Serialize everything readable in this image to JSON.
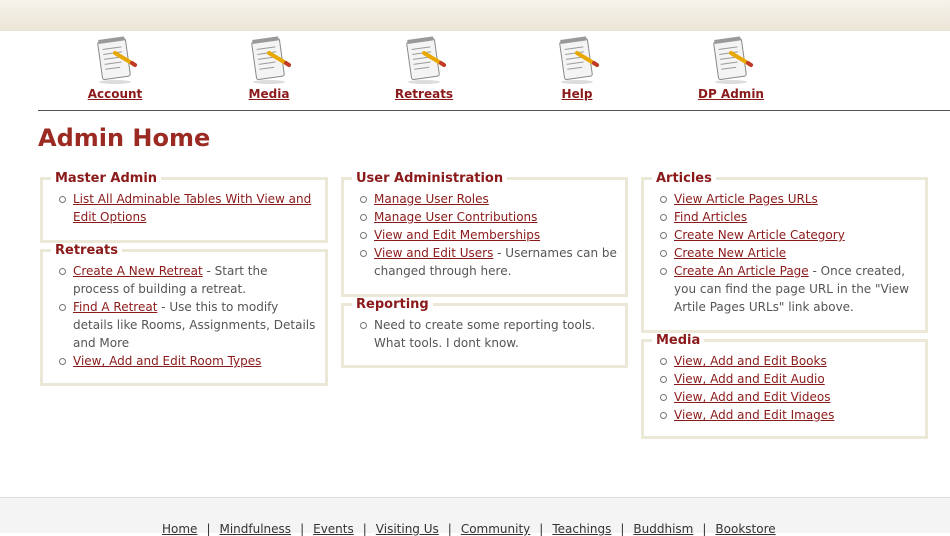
{
  "top_nav": [
    {
      "label": "Account",
      "icon": "notepad-pencil-icon"
    },
    {
      "label": "Media",
      "icon": "notepad-pencil-icon"
    },
    {
      "label": "Retreats",
      "icon": "notepad-pencil-icon"
    },
    {
      "label": "Help",
      "icon": "notepad-pencil-icon"
    },
    {
      "label": "DP Admin",
      "icon": "notepad-pencil-icon"
    }
  ],
  "page_title": "Admin Home",
  "panels": {
    "master_admin": {
      "title": "Master Admin",
      "items": [
        {
          "link": "List All Adminable Tables With View and Edit Options",
          "desc": ""
        }
      ]
    },
    "retreats": {
      "title": "Retreats",
      "items": [
        {
          "link": "Create A New Retreat",
          "desc": " - Start the process of building a retreat."
        },
        {
          "link": "Find A Retreat",
          "desc": " - Use this to modify details like Rooms, Assignments, Details and More"
        },
        {
          "link": "View, Add and Edit Room Types",
          "desc": ""
        }
      ]
    },
    "user_admin": {
      "title": "User Administration",
      "items": [
        {
          "link": "Manage User Roles",
          "desc": ""
        },
        {
          "link": "Manage User Contributions",
          "desc": ""
        },
        {
          "link": "View and Edit Memberships",
          "desc": ""
        },
        {
          "link": "View and Edit Users",
          "desc": " - Usernames can be changed through here."
        }
      ]
    },
    "reporting": {
      "title": "Reporting",
      "items": [
        {
          "link": "",
          "desc": "Need to create some reporting tools. What tools. I dont know."
        }
      ]
    },
    "articles": {
      "title": "Articles",
      "items": [
        {
          "link": "View Article Pages URLs",
          "desc": ""
        },
        {
          "link": "Find Articles",
          "desc": ""
        },
        {
          "link": "Create New Article Category",
          "desc": ""
        },
        {
          "link": "Create New Article",
          "desc": ""
        },
        {
          "link": "Create An Article Page",
          "desc": " - Once created, you can find the page URL in the \"View Artile Pages URLs\" link above."
        }
      ]
    },
    "media": {
      "title": "Media",
      "items": [
        {
          "link": "View, Add and Edit Books",
          "desc": ""
        },
        {
          "link": "View, Add and Edit Audio",
          "desc": ""
        },
        {
          "link": "View, Add and Edit Videos",
          "desc": ""
        },
        {
          "link": "View, Add and Edit Images",
          "desc": ""
        }
      ]
    }
  },
  "footer_nav": [
    "Home",
    "Mindfulness",
    "Events",
    "Visiting Us",
    "Community",
    "Teachings",
    "Buddhism",
    "Bookstore"
  ],
  "colors": {
    "accent": "#8b1a1a",
    "title": "#9b2a22",
    "panel_border": "#ece8d8"
  }
}
